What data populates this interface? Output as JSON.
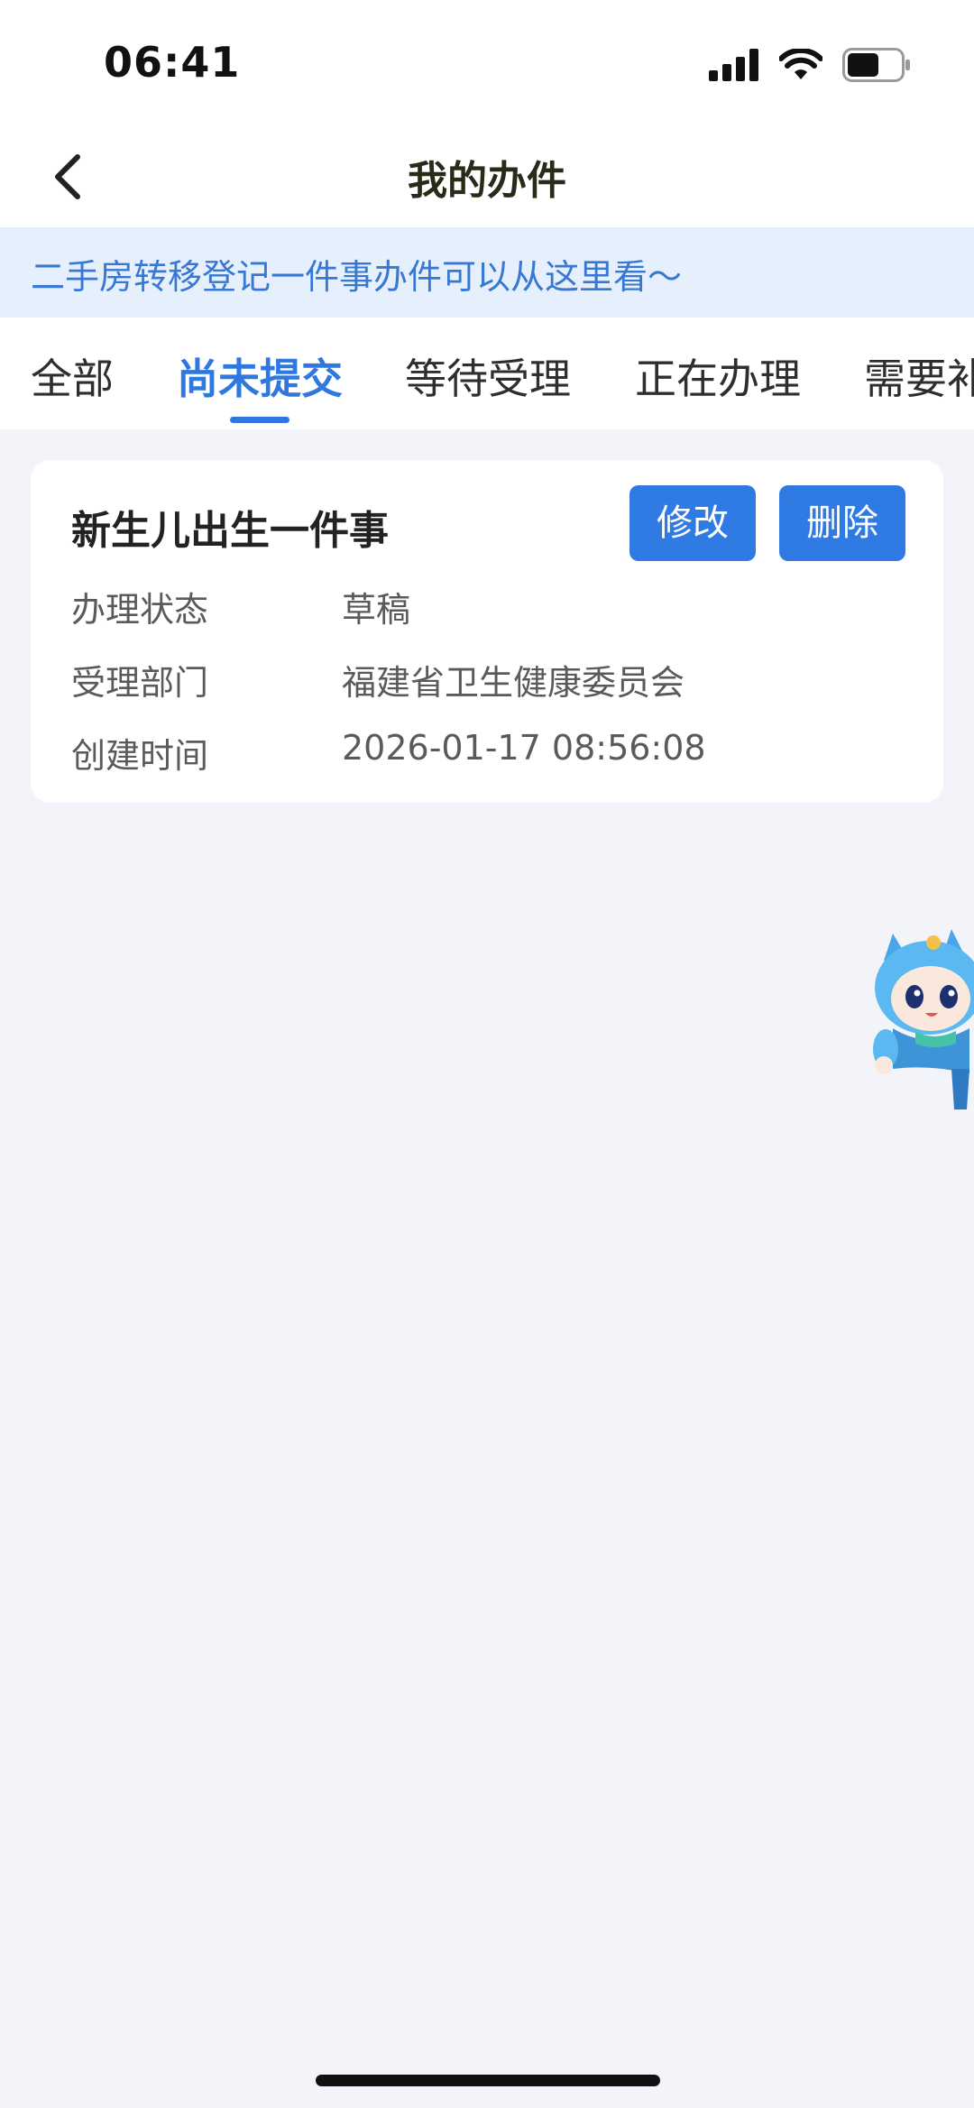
{
  "status_bar": {
    "time": "06:41",
    "battery_level": 0.6
  },
  "nav": {
    "title": "我的办件",
    "back_icon": "chevron-left-icon"
  },
  "banner": {
    "text": "二手房转移登记一件事办件可以从这里看～"
  },
  "tabs": [
    {
      "label": "全部",
      "active": false
    },
    {
      "label": "尚未提交",
      "active": true
    },
    {
      "label": "等待受理",
      "active": false
    },
    {
      "label": "正在办理",
      "active": false
    },
    {
      "label": "需要补",
      "active": false
    }
  ],
  "card": {
    "title": "新生儿出生一件事",
    "edit_label": "修改",
    "delete_label": "删除",
    "rows": [
      {
        "label": "办理状态",
        "value": "草稿"
      },
      {
        "label": "受理部门",
        "value": "福建省卫生健康委员会"
      },
      {
        "label": "创建时间",
        "value": "2026-01-17 08:56:08"
      }
    ]
  },
  "colors": {
    "accent": "#2f78e0",
    "banner_bg": "#e5f0fc",
    "banner_text": "#3878d4",
    "page_bg": "#f3f4f9"
  }
}
